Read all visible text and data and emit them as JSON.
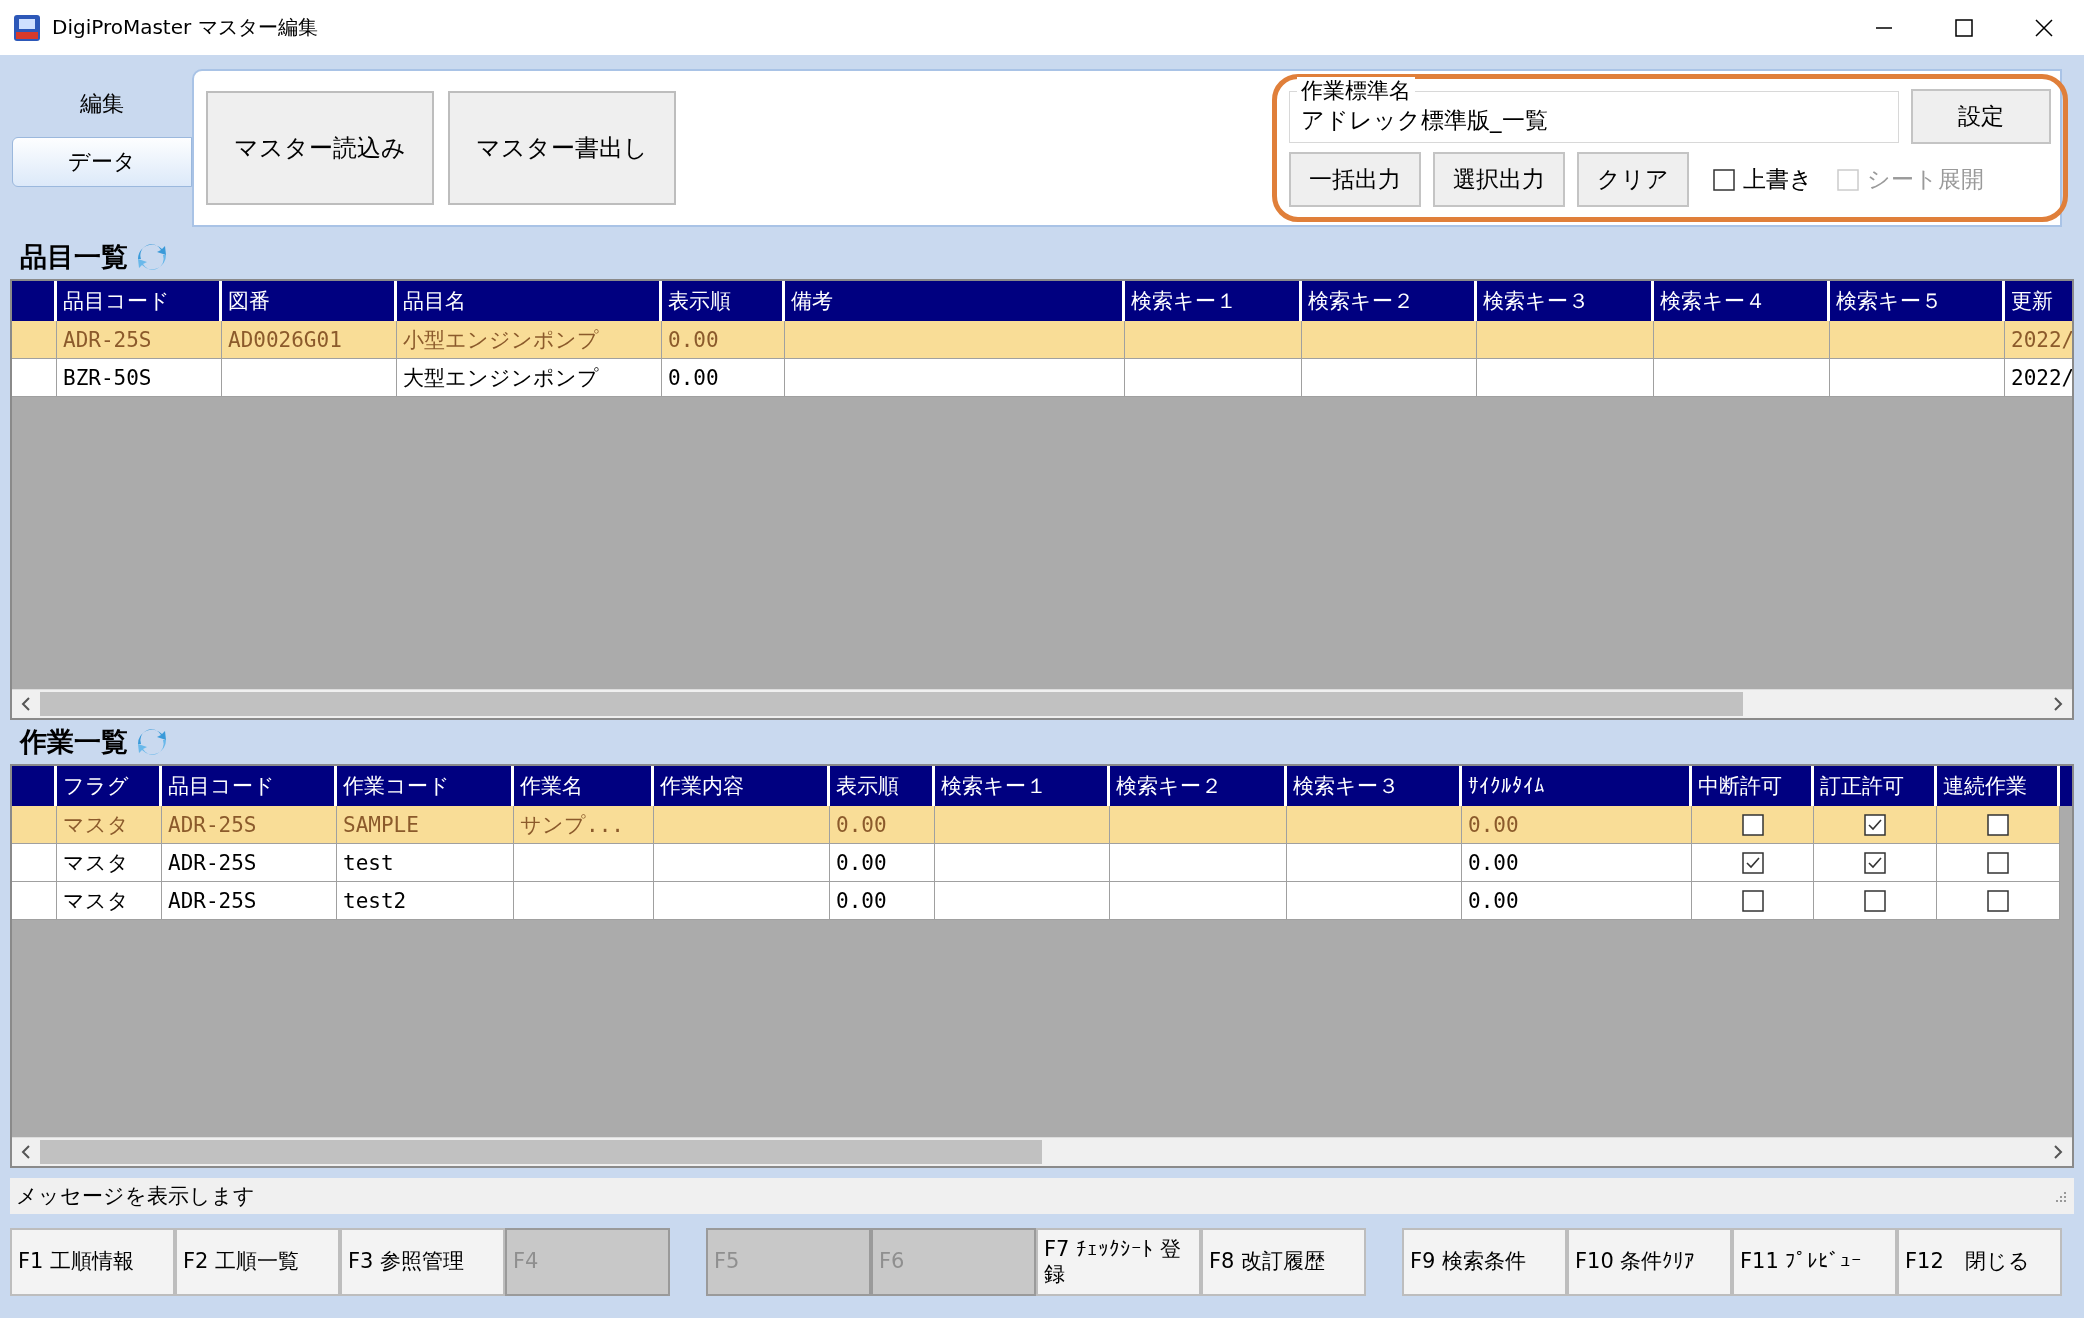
{
  "window": {
    "title": "DigiProMaster マスター編集"
  },
  "ribbon": {
    "tabs": [
      {
        "label": "編集",
        "selected": false
      },
      {
        "label": "データ",
        "selected": true
      }
    ],
    "buttons": [
      "マスター読込み",
      "マスター書出し"
    ]
  },
  "work_standard": {
    "label": "作業標準名",
    "value": "アドレック標準版_一覧",
    "set_button": "設定",
    "buttons": [
      "一括出力",
      "選択出力",
      "クリア"
    ],
    "checkboxes": [
      {
        "label": "上書き",
        "checked": false,
        "disabled": false
      },
      {
        "label": "シート展開",
        "checked": false,
        "disabled": true
      }
    ]
  },
  "tables": [
    {
      "title": "品目一覧",
      "columns": [
        {
          "label": "品目コード",
          "kind": "text"
        },
        {
          "label": "図番",
          "kind": "text"
        },
        {
          "label": "品目名",
          "kind": "text"
        },
        {
          "label": "表示順",
          "kind": "text"
        },
        {
          "label": "備考",
          "kind": "text"
        },
        {
          "label": "検索キー１",
          "kind": "text"
        },
        {
          "label": "検索キー２",
          "kind": "text"
        },
        {
          "label": "検索キー３",
          "kind": "text"
        },
        {
          "label": "検索キー４",
          "kind": "text"
        },
        {
          "label": "検索キー５",
          "kind": "text"
        },
        {
          "label": "更新",
          "kind": "text"
        }
      ],
      "rows": [
        {
          "selected": true,
          "cells": [
            "ADR-25S",
            "AD0026G01",
            "小型エンジンポンプ",
            "0.00",
            null,
            null,
            null,
            null,
            null,
            null,
            "2022/"
          ]
        },
        {
          "selected": false,
          "cells": [
            "BZR-50S",
            null,
            "大型エンジンポンプ",
            "0.00",
            null,
            null,
            null,
            null,
            null,
            null,
            "2022/"
          ]
        }
      ]
    },
    {
      "title": "作業一覧",
      "columns": [
        {
          "label": "フラグ",
          "kind": "text"
        },
        {
          "label": "品目コード",
          "kind": "text"
        },
        {
          "label": "作業コード",
          "kind": "text"
        },
        {
          "label": "作業名",
          "kind": "text"
        },
        {
          "label": "作業内容",
          "kind": "text"
        },
        {
          "label": "表示順",
          "kind": "text"
        },
        {
          "label": "検索キー１",
          "kind": "text"
        },
        {
          "label": "検索キー２",
          "kind": "text"
        },
        {
          "label": "検索キー３",
          "kind": "text"
        },
        {
          "label": "ｻｲｸﾙﾀｲﾑ",
          "kind": "text"
        },
        {
          "label": "中断許可",
          "kind": "check"
        },
        {
          "label": "訂正許可",
          "kind": "check"
        },
        {
          "label": "連続作業",
          "kind": "check"
        }
      ],
      "rows": [
        {
          "selected": true,
          "cells": [
            "マスタ",
            "ADR-25S",
            "SAMPLE",
            "サンプ...",
            null,
            "0.00",
            null,
            null,
            null,
            "0.00",
            false,
            true,
            false
          ]
        },
        {
          "selected": false,
          "cells": [
            "マスタ",
            "ADR-25S",
            "test",
            null,
            null,
            "0.00",
            null,
            null,
            null,
            "0.00",
            true,
            true,
            false
          ]
        },
        {
          "selected": false,
          "cells": [
            "マスタ",
            "ADR-25S",
            "test2",
            null,
            null,
            "0.00",
            null,
            null,
            null,
            "0.00",
            false,
            false,
            false
          ]
        }
      ]
    }
  ],
  "message": "メッセージを表示します",
  "function_keys": [
    {
      "label": "F1 工順情報",
      "disabled": false
    },
    {
      "label": "F2 工順一覧",
      "disabled": false
    },
    {
      "label": "F3 参照管理",
      "disabled": false
    },
    {
      "label": "F4",
      "disabled": true
    },
    {
      "label": "F5",
      "disabled": true
    },
    {
      "label": "F6",
      "disabled": true
    },
    {
      "label": "F7 ﾁｪｯｸｼｰﾄ 登録",
      "disabled": false
    },
    {
      "label": "F8 改訂履歴",
      "disabled": false
    },
    {
      "label": "F9 検索条件",
      "disabled": false
    },
    {
      "label": "F10 条件ｸﾘｱ",
      "disabled": false
    },
    {
      "label": "F11 ﾌﾟﾚﾋﾞｭｰ",
      "disabled": false
    },
    {
      "label": "F12　閉じる",
      "disabled": false
    }
  ]
}
